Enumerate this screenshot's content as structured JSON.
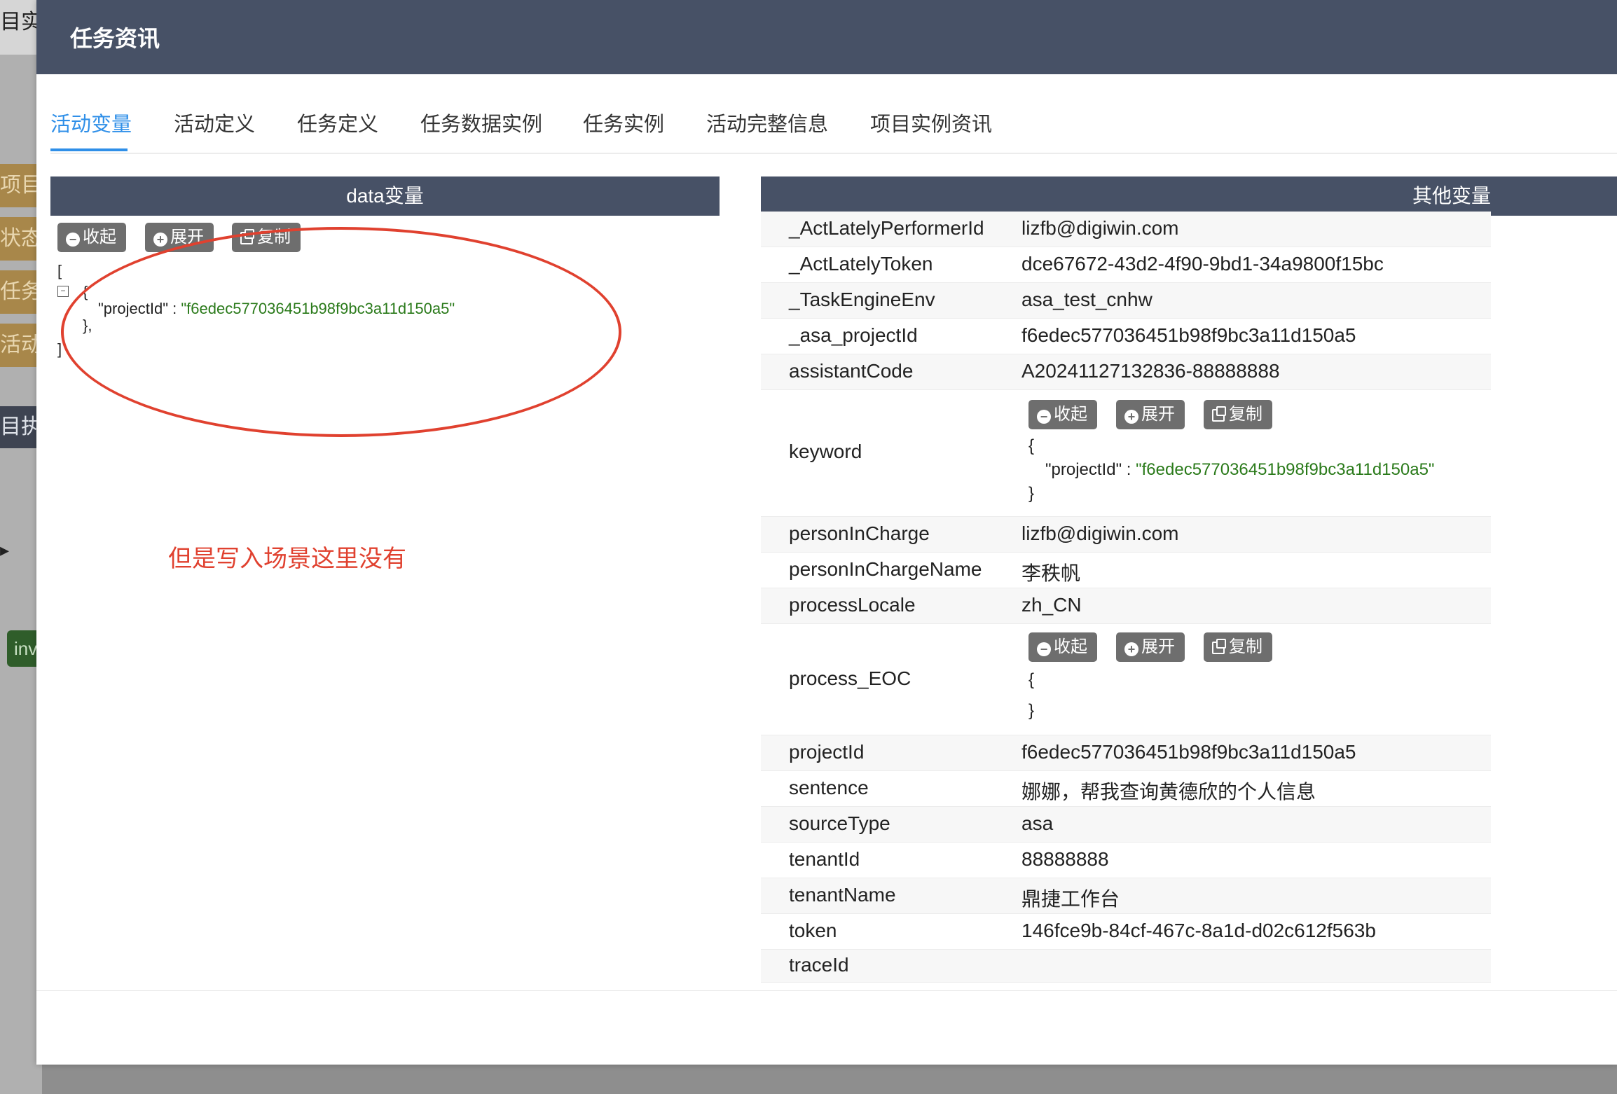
{
  "background": {
    "top_text": "目实",
    "tags": [
      "项目",
      "状态",
      "任务",
      "活动"
    ],
    "dark_item": "目执",
    "green_badge": "inv"
  },
  "modal": {
    "title": "任务资讯",
    "tabs": [
      "活动变量",
      "活动定义",
      "任务定义",
      "任务数据实例",
      "任务实例",
      "活动完整信息",
      "项目实例资讯"
    ],
    "active_tab": "活动变量"
  },
  "left_panel": {
    "title": "data变量",
    "buttons": {
      "collapse": "收起",
      "expand": "展开",
      "copy": "复制"
    },
    "json_open_bracket": "[",
    "json_open_brace": "{",
    "json_key": "\"projectId\"",
    "json_sep": " : ",
    "json_value": "\"f6edec577036451b98f9bc3a11d150a5\"",
    "json_close_brace": "},",
    "json_close_bracket": "]",
    "annotation": "但是写入场景这里没有"
  },
  "right_panel": {
    "title": "其他变量",
    "rows": [
      {
        "key": "_ActLatelyPerformerId",
        "value": "lizfb@digiwin.com"
      },
      {
        "key": "_ActLatelyToken",
        "value": "dce67672-43d2-4f90-9bd1-34a9800f15bc"
      },
      {
        "key": "_TaskEngineEnv",
        "value": "asa_test_cnhw"
      },
      {
        "key": "_asa_projectId",
        "value": "f6edec577036451b98f9bc3a11d150a5"
      },
      {
        "key": "assistantCode",
        "value": "A20241127132836-88888888"
      },
      {
        "key": "keyword",
        "value": ""
      },
      {
        "key": "personInCharge",
        "value": "lizfb@digiwin.com"
      },
      {
        "key": "personInChargeName",
        "value": "李秩帆"
      },
      {
        "key": "processLocale",
        "value": "zh_CN"
      },
      {
        "key": "process_EOC",
        "value": ""
      },
      {
        "key": "projectId",
        "value": "f6edec577036451b98f9bc3a11d150a5"
      },
      {
        "key": "sentence",
        "value": "娜娜，帮我查询黄德欣的个人信息"
      },
      {
        "key": "sourceType",
        "value": "asa"
      },
      {
        "key": "tenantId",
        "value": "88888888"
      },
      {
        "key": "tenantName",
        "value": "鼎捷工作台"
      },
      {
        "key": "token",
        "value": "146fce9b-84cf-467c-8a1d-d02c612f563b"
      },
      {
        "key": "traceId",
        "value": ""
      }
    ],
    "keyword_json": {
      "open": "{",
      "key": "\"projectId\"",
      "sep": " : ",
      "value": "\"f6edec577036451b98f9bc3a11d150a5\"",
      "close": "}"
    },
    "eoc_json": {
      "open": "{",
      "close": "}"
    }
  }
}
